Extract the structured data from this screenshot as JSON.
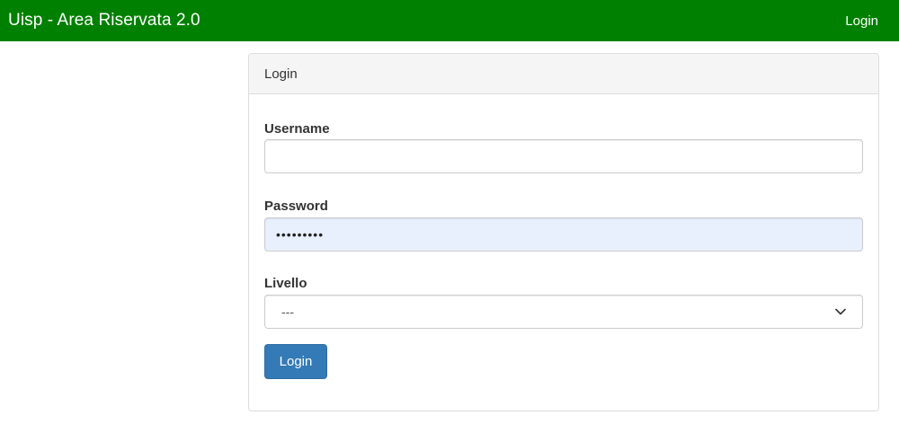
{
  "navbar": {
    "brand": "Uisp - Area Riservata 2.0",
    "login_link": "Login"
  },
  "panel": {
    "heading": "Login"
  },
  "form": {
    "username_label": "Username",
    "username_value": "",
    "password_label": "Password",
    "password_mask": "•••••••••",
    "livello_label": "Livello",
    "livello_selected": "---",
    "submit_label": "Login"
  },
  "colors": {
    "navbar_bg": "#008000",
    "button_bg": "#337ab7",
    "autofill_bg": "#e8f0fe"
  },
  "icons": {
    "select_chevron": "chevron-down-icon"
  }
}
